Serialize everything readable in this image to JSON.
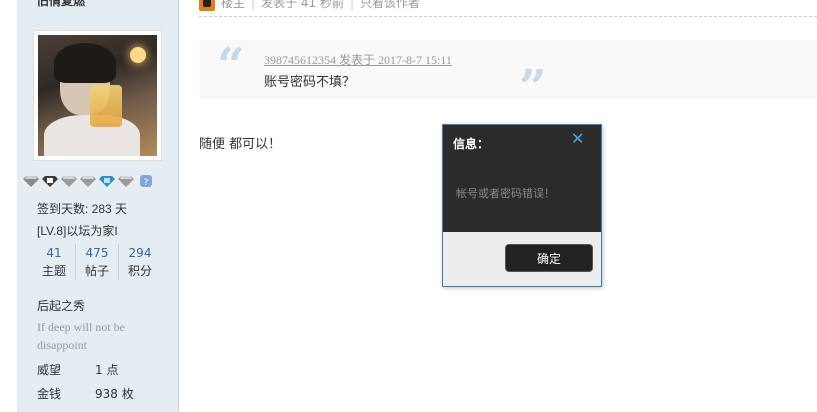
{
  "sidebar": {
    "username": "旧情复燃",
    "signin_days": "签到天数: 283 天",
    "level": "[LV.8]以坛为家I",
    "counts": [
      {
        "num": "41",
        "label": "主题"
      },
      {
        "num": "475",
        "label": "帖子"
      },
      {
        "num": "294",
        "label": "积分"
      }
    ],
    "user_title": "后起之秀",
    "signature": "If deep will not be disappoint",
    "prestige_label": "威望",
    "prestige_value": "1 点",
    "money_label": "金钱",
    "money_value": "938 枚",
    "medal_colors": [
      "#8a8a8a",
      "#3a3a3a",
      "#9a9a9a",
      "#9a9a9a",
      "#2f8ed6",
      "#9a9a9a",
      "#7fa7d8"
    ]
  },
  "post": {
    "header": {
      "owner_label": "楼主",
      "posted_time": "发表于 41 秒前",
      "only_author": "只看该作者"
    },
    "quote": {
      "meta": "398745612354 发表于 2017-8-7 15:11",
      "text": "账号密码不填？"
    },
    "reply_text": "随便 都可以！"
  },
  "dialog": {
    "title": "信息：",
    "close_glyph": "✕",
    "message": "帐号或者密码错误！",
    "ok_label": "确定"
  }
}
